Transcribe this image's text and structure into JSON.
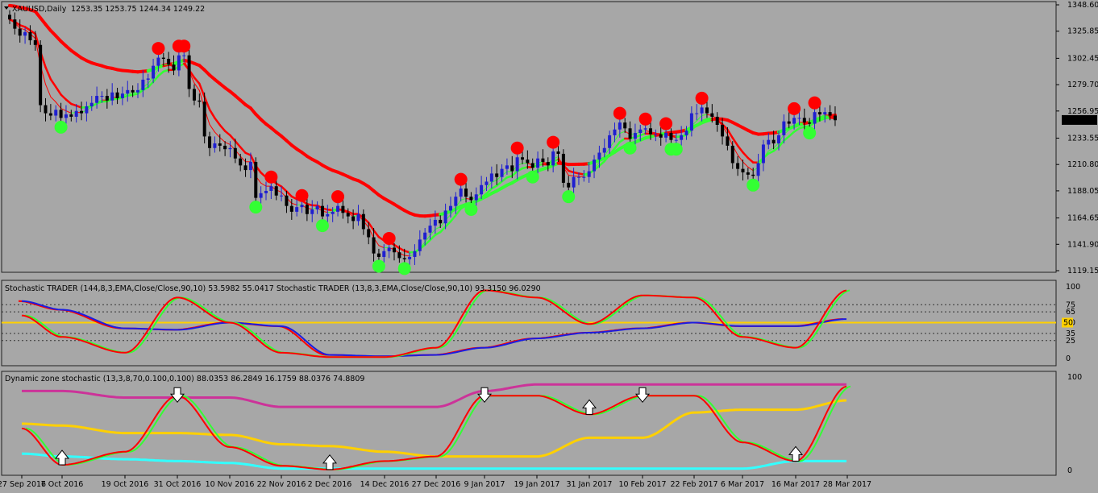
{
  "header": {
    "symbol": "XAUUSD,Daily",
    "ohlc": "1253.35 1253.75 1244.34 1249.22",
    "menu_icon": "triangle-down-icon"
  },
  "colors": {
    "background": "#a7a7a7",
    "bull_candle": "#1f1fd0",
    "bear_candle": "#000000",
    "red_line": "#ff0000",
    "green_line": "#33ff33",
    "gold_line": "#ffd000",
    "magenta_line": "#cc3399",
    "cyan_line": "#33ffff",
    "blue_line": "#1c1ce0"
  },
  "x_axis": {
    "labels": [
      "27 Sep 2016",
      "7 Oct 2016",
      "19 Oct 2016",
      "31 Oct 2016",
      "10 Nov 2016",
      "22 Nov 2016",
      "2 Dec 2016",
      "14 Dec 2016",
      "27 Dec 2016",
      "9 Jan 2017",
      "19 Jan 2017",
      "31 Jan 2017",
      "10 Feb 2017",
      "22 Feb 2017",
      "6 Mar 2017",
      "16 Mar 2017",
      "28 Mar 2017"
    ]
  },
  "panels": {
    "price": {
      "y_labels": [
        "1348.60",
        "1325.85",
        "1302.45",
        "1279.70",
        "1256.95",
        "1233.55",
        "1210.80",
        "1188.05",
        "1164.65",
        "1141.90",
        "1119.15"
      ],
      "current_price": "1249.22"
    },
    "stochastic": {
      "title": "Stochastic TRADER (144,8,3,EMA,Close/Close,90,10) 53.5982 55.0417  Stochastic TRADER (13,8,3,EMA,Close/Close,90,10) 93.3150 96.0290",
      "y_labels": [
        "100",
        "75",
        "65",
        "50",
        "35",
        "25",
        "0"
      ],
      "marker": "50"
    },
    "dzs": {
      "title": "Dynamic zone stochastic (13,3,8,70,0.100,0.100) 88.0353 86.2849 16.1759 88.0376 74.8809",
      "y_labels": [
        "100",
        "0"
      ]
    }
  },
  "chart_data": [
    {
      "type": "candlestick",
      "title": "XAUUSD,Daily",
      "x_labels": [
        "27 Sep 2016",
        "7 Oct 2016",
        "19 Oct 2016",
        "31 Oct 2016",
        "10 Nov 2016",
        "22 Nov 2016",
        "2 Dec 2016",
        "14 Dec 2016",
        "27 Dec 2016",
        "9 Jan 2017",
        "19 Jan 2017",
        "31 Jan 2017",
        "10 Feb 2017",
        "22 Feb 2017",
        "6 Mar 2017",
        "16 Mar 2017",
        "28 Mar 2017"
      ],
      "ylim": [
        1119.15,
        1348.6
      ],
      "close": [
        1336,
        1328,
        1322,
        1325,
        1318,
        1314,
        1262,
        1255,
        1253,
        1258,
        1251,
        1254,
        1252,
        1257,
        1255,
        1261,
        1264,
        1270,
        1270,
        1266,
        1273,
        1268,
        1272,
        1275,
        1273,
        1275,
        1284,
        1285,
        1296,
        1303,
        1302,
        1297,
        1292,
        1305,
        1305,
        1276,
        1266,
        1265,
        1235,
        1225,
        1229,
        1227,
        1224,
        1225,
        1216,
        1210,
        1206,
        1213,
        1182,
        1186,
        1188,
        1192,
        1184,
        1184,
        1175,
        1170,
        1174,
        1176,
        1168,
        1172,
        1175,
        1166,
        1168,
        1170,
        1175,
        1169,
        1166,
        1162,
        1168,
        1155,
        1148,
        1134,
        1131,
        1136,
        1139,
        1135,
        1130,
        1129,
        1131,
        1136,
        1146,
        1152,
        1158,
        1163,
        1160,
        1171,
        1175,
        1183,
        1190,
        1183,
        1180,
        1185,
        1193,
        1196,
        1203,
        1200,
        1207,
        1210,
        1205,
        1217,
        1215,
        1212,
        1208,
        1216,
        1213,
        1210,
        1222,
        1220,
        1195,
        1191,
        1200,
        1200,
        1200,
        1205,
        1215,
        1221,
        1225,
        1236,
        1241,
        1247,
        1242,
        1233,
        1238,
        1241,
        1242,
        1237,
        1237,
        1234,
        1238,
        1232,
        1232,
        1236,
        1240,
        1255,
        1255,
        1260,
        1255,
        1252,
        1245,
        1235,
        1227,
        1212,
        1207,
        1204,
        1202,
        1201,
        1212,
        1228,
        1232,
        1229,
        1236,
        1248,
        1246,
        1251,
        1251,
        1247,
        1246,
        1256,
        1254,
        1256,
        1253,
        1249
      ]
    },
    {
      "type": "line",
      "title": "Stochastic TRADER (144,8,3,EMA,Close/Close,90,10)",
      "ylim": [
        0,
        100
      ],
      "levels": [
        100,
        75,
        65,
        50,
        35,
        25,
        0
      ],
      "series": [
        {
          "values_at_labels": [
            80,
            68,
            42,
            40,
            50,
            45,
            5,
            3,
            5,
            15,
            28,
            36,
            42,
            50,
            45,
            45,
            55
          ]
        },
        {
          "values_at_labels": [
            60,
            30,
            8,
            85,
            50,
            8,
            2,
            2,
            15,
            95,
            85,
            48,
            88,
            85,
            30,
            15,
            95
          ]
        }
      ]
    },
    {
      "type": "line",
      "title": "Dynamic zone stochastic (13,3,8,70,0.100,0.100)",
      "ylim": [
        0,
        100
      ],
      "series": [
        {
          "values_at_labels": [
            85,
            85,
            78,
            78,
            78,
            68,
            68,
            68,
            68,
            85,
            92,
            92,
            92,
            92,
            92,
            92,
            92
          ]
        },
        {
          "values_at_labels": [
            50,
            48,
            40,
            40,
            38,
            28,
            26,
            20,
            15,
            15,
            15,
            35,
            35,
            62,
            65,
            65,
            75
          ]
        },
        {
          "values_at_labels": [
            18,
            15,
            12,
            10,
            8,
            2,
            2,
            2,
            2,
            2,
            2,
            2,
            2,
            2,
            2,
            10,
            10
          ]
        },
        {
          "values_at_labels": [
            45,
            6,
            20,
            80,
            25,
            5,
            1,
            10,
            15,
            80,
            80,
            60,
            80,
            80,
            30,
            10,
            90
          ]
        }
      ]
    }
  ]
}
